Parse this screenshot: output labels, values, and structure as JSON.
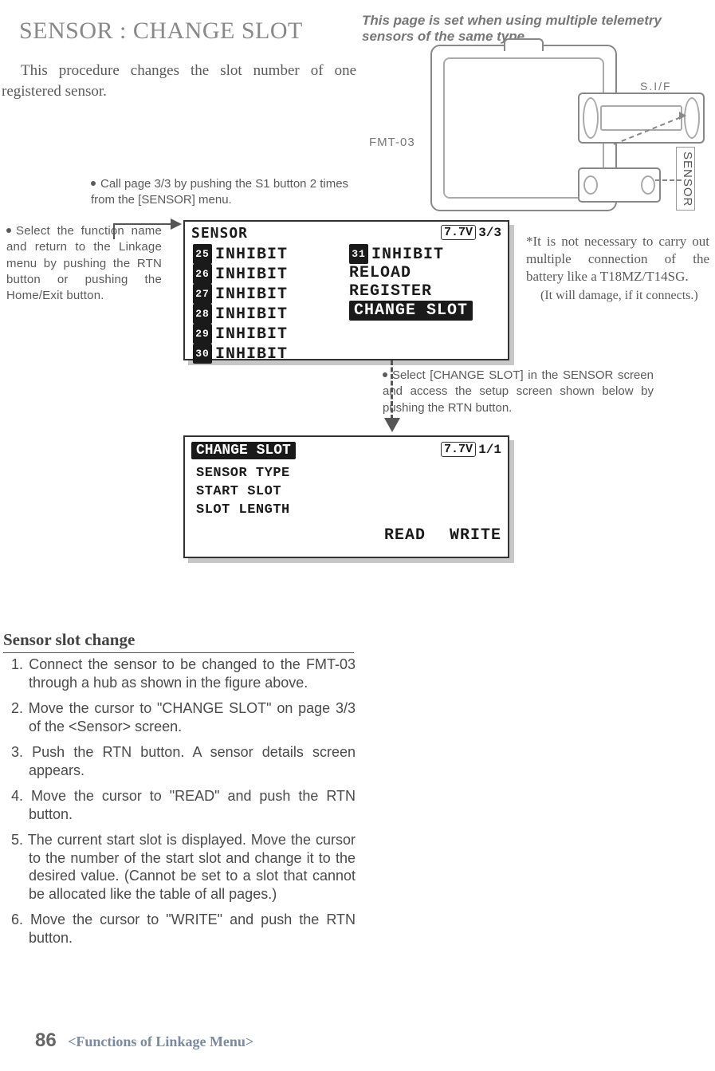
{
  "title": "SENSOR : CHANGE SLOT",
  "intro": "This procedure changes the slot number of one registered sensor.",
  "topnote": "This page is set when using multiple telemetry sensors of the same type.",
  "hw": {
    "fmt_label": "FMT-03",
    "sif_label": "S.I/F",
    "sensor_label": "SENSOR"
  },
  "tip1": "Call page 3/3 by pushing the S1 button 2 times from the [SENSOR] menu.",
  "tip2": "Select the function name and return to the Linkage menu by pushing the RTN button or pushing the Home/Exit button.",
  "tip3": "Select [CHANGE SLOT] in the SENSOR screen and access the setup screen shown below by pushing the RTN button.",
  "asterisk1": "*It is not necessary to carry out multiple connection of the battery like a T18MZ/T14SG.",
  "asterisk2": "(It will damage, if it connects.)",
  "lcd1": {
    "title": "SENSOR",
    "batt": "7.7V",
    "page": "3/3",
    "left": [
      {
        "n": "25",
        "t": "INHIBIT"
      },
      {
        "n": "26",
        "t": "INHIBIT"
      },
      {
        "n": "27",
        "t": "INHIBIT"
      },
      {
        "n": "28",
        "t": "INHIBIT"
      },
      {
        "n": "29",
        "t": "INHIBIT"
      },
      {
        "n": "30",
        "t": "INHIBIT"
      }
    ],
    "right_num": "31",
    "right": [
      "INHIBIT",
      "RELOAD",
      "REGISTER"
    ],
    "right_selected": "CHANGE SLOT"
  },
  "lcd2": {
    "title": "CHANGE SLOT",
    "batt": "7.7V",
    "page": "1/1",
    "rows": [
      "SENSOR TYPE",
      "START SLOT",
      "SLOT LENGTH"
    ],
    "read": "READ",
    "write": "WRITE"
  },
  "section_title": "Sensor slot change",
  "steps": [
    "1. Connect the sensor to be changed to the FMT-03 through a hub as shown in the figure above.",
    "2. Move the cursor to \"CHANGE SLOT\" on page 3/3 of the <Sensor> screen.",
    "3. Push the RTN button. A sensor details screen appears.",
    "4. Move the cursor to \"READ\" and push the RTN button.",
    "5. The current start slot is displayed. Move the cursor to the number of the start slot and change it to the desired value.  (Cannot be set to a slot that cannot be allocated like the table of all pages.)",
    "6. Move the cursor to \"WRITE\" and push the RTN button."
  ],
  "footer": {
    "page": "86",
    "text": "<Functions of Linkage Menu>"
  }
}
